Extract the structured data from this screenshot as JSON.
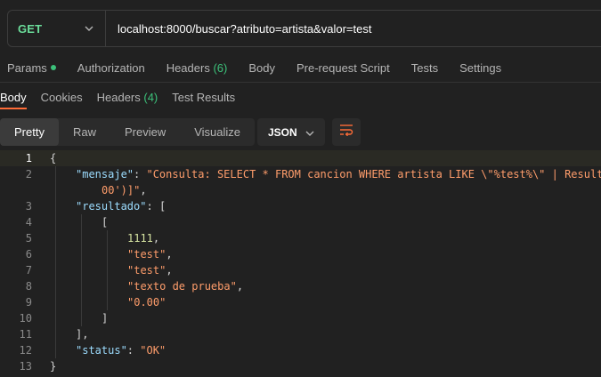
{
  "request": {
    "method": "GET",
    "url": "localhost:8000/buscar?atributo=artista&valor=test"
  },
  "request_tabs": [
    {
      "label": "Params",
      "indicator": true
    },
    {
      "label": "Authorization"
    },
    {
      "label": "Headers",
      "count": "(6)"
    },
    {
      "label": "Body"
    },
    {
      "label": "Pre-request Script"
    },
    {
      "label": "Tests"
    },
    {
      "label": "Settings"
    }
  ],
  "response_tabs": [
    {
      "label": "Body",
      "active": true
    },
    {
      "label": "Cookies"
    },
    {
      "label": "Headers",
      "count": "(4)"
    },
    {
      "label": "Test Results"
    }
  ],
  "view_modes": [
    "Pretty",
    "Raw",
    "Preview",
    "Visualize"
  ],
  "active_view": "Pretty",
  "format": "JSON",
  "icons": {
    "method_dropdown": "chevron-down-icon",
    "format_dropdown": "chevron-down-icon",
    "wrap": "wrap-lines-icon"
  },
  "colors": {
    "method": "#6bdd9a",
    "accent": "#ff6c37",
    "key": "#9cdcfe",
    "string": "#ff9d6b",
    "number": "#d7e4a2"
  },
  "code_lines": {
    "l1": {
      "num": "1",
      "bracket": "{"
    },
    "l2": {
      "num": "2",
      "key": "\"mensaje\"",
      "colon": ": ",
      "value": "\"Consulta: SELECT * FROM cancion WHERE artista LIKE \\\"%test%\\\" | Result"
    },
    "l2b": {
      "value": "00')]\"",
      "comma": ","
    },
    "l3": {
      "num": "3",
      "key": "\"resultado\"",
      "colon": ": ",
      "bracket": "["
    },
    "l4": {
      "num": "4",
      "bracket": "["
    },
    "l5": {
      "num": "5",
      "value": "1111",
      "comma": ","
    },
    "l6": {
      "num": "6",
      "value": "\"test\"",
      "comma": ","
    },
    "l7": {
      "num": "7",
      "value": "\"test\"",
      "comma": ","
    },
    "l8": {
      "num": "8",
      "value": "\"texto de prueba\"",
      "comma": ","
    },
    "l9": {
      "num": "9",
      "value": "\"0.00\""
    },
    "l10": {
      "num": "10",
      "bracket": "]"
    },
    "l11": {
      "num": "11",
      "bracket": "],"
    },
    "l12": {
      "num": "12",
      "key": "\"status\"",
      "colon": ": ",
      "value": "\"OK\""
    },
    "l13": {
      "num": "13",
      "bracket": "}"
    }
  }
}
